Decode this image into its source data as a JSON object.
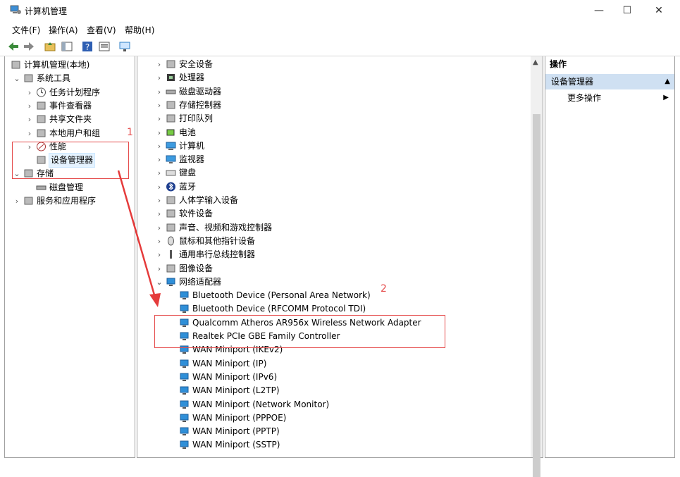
{
  "window": {
    "title": "计算机管理"
  },
  "menu": [
    "文件(F)",
    "操作(A)",
    "查看(V)",
    "帮助(H)"
  ],
  "left_tree": [
    {
      "label": "计算机管理(本地)",
      "exp": "",
      "indent": 0,
      "icon": "computer-management-icon"
    },
    {
      "label": "系统工具",
      "exp": "∨",
      "indent": 1,
      "icon": "tools-icon"
    },
    {
      "label": "任务计划程序",
      "exp": ">",
      "indent": 2,
      "icon": "clock-icon"
    },
    {
      "label": "事件查看器",
      "exp": ">",
      "indent": 2,
      "icon": "event-viewer-icon"
    },
    {
      "label": "共享文件夹",
      "exp": ">",
      "indent": 2,
      "icon": "shared-folder-icon"
    },
    {
      "label": "本地用户和组",
      "exp": ">",
      "indent": 2,
      "icon": "users-icon"
    },
    {
      "label": "性能",
      "exp": ">",
      "indent": 2,
      "icon": "performance-icon"
    },
    {
      "label": "设备管理器",
      "exp": "",
      "indent": 2,
      "icon": "device-manager-icon"
    },
    {
      "label": "存储",
      "exp": "∨",
      "indent": 1,
      "icon": "storage-icon"
    },
    {
      "label": "磁盘管理",
      "exp": "",
      "indent": 2,
      "icon": "disk-icon"
    },
    {
      "label": "服务和应用程序",
      "exp": ">",
      "indent": 1,
      "icon": "services-icon"
    }
  ],
  "device_tree": [
    {
      "label": "安全设备",
      "exp": ">",
      "indent": 0,
      "icon": "security-device-icon"
    },
    {
      "label": "处理器",
      "exp": ">",
      "indent": 0,
      "icon": "processor-icon"
    },
    {
      "label": "磁盘驱动器",
      "exp": ">",
      "indent": 0,
      "icon": "disk-drive-icon"
    },
    {
      "label": "存储控制器",
      "exp": ">",
      "indent": 0,
      "icon": "storage-controller-icon"
    },
    {
      "label": "打印队列",
      "exp": ">",
      "indent": 0,
      "icon": "printer-icon"
    },
    {
      "label": "电池",
      "exp": ">",
      "indent": 0,
      "icon": "battery-icon"
    },
    {
      "label": "计算机",
      "exp": ">",
      "indent": 0,
      "icon": "computer-icon"
    },
    {
      "label": "监视器",
      "exp": ">",
      "indent": 0,
      "icon": "monitor-icon"
    },
    {
      "label": "键盘",
      "exp": ">",
      "indent": 0,
      "icon": "keyboard-icon"
    },
    {
      "label": "蓝牙",
      "exp": ">",
      "indent": 0,
      "icon": "bluetooth-icon"
    },
    {
      "label": "人体学输入设备",
      "exp": ">",
      "indent": 0,
      "icon": "hid-icon"
    },
    {
      "label": "软件设备",
      "exp": ">",
      "indent": 0,
      "icon": "software-device-icon"
    },
    {
      "label": "声音、视频和游戏控制器",
      "exp": ">",
      "indent": 0,
      "icon": "sound-icon"
    },
    {
      "label": "鼠标和其他指针设备",
      "exp": ">",
      "indent": 0,
      "icon": "mouse-icon"
    },
    {
      "label": "通用串行总线控制器",
      "exp": ">",
      "indent": 0,
      "icon": "usb-icon"
    },
    {
      "label": "图像设备",
      "exp": ">",
      "indent": 0,
      "icon": "camera-icon"
    },
    {
      "label": "网络适配器",
      "exp": "∨",
      "indent": 0,
      "icon": "network-adapter-icon"
    },
    {
      "label": "Bluetooth Device (Personal Area Network)",
      "exp": "",
      "indent": 1,
      "icon": "network-adapter-icon"
    },
    {
      "label": "Bluetooth Device (RFCOMM Protocol TDI)",
      "exp": "",
      "indent": 1,
      "icon": "network-adapter-icon"
    },
    {
      "label": "Qualcomm Atheros AR956x Wireless Network Adapter",
      "exp": "",
      "indent": 1,
      "icon": "network-adapter-icon"
    },
    {
      "label": "Realtek PCIe GBE Family Controller",
      "exp": "",
      "indent": 1,
      "icon": "network-adapter-icon"
    },
    {
      "label": "WAN Miniport (IKEv2)",
      "exp": "",
      "indent": 1,
      "icon": "network-adapter-icon"
    },
    {
      "label": "WAN Miniport (IP)",
      "exp": "",
      "indent": 1,
      "icon": "network-adapter-icon"
    },
    {
      "label": "WAN Miniport (IPv6)",
      "exp": "",
      "indent": 1,
      "icon": "network-adapter-icon"
    },
    {
      "label": "WAN Miniport (L2TP)",
      "exp": "",
      "indent": 1,
      "icon": "network-adapter-icon"
    },
    {
      "label": "WAN Miniport (Network Monitor)",
      "exp": "",
      "indent": 1,
      "icon": "network-adapter-icon"
    },
    {
      "label": "WAN Miniport (PPPOE)",
      "exp": "",
      "indent": 1,
      "icon": "network-adapter-icon"
    },
    {
      "label": "WAN Miniport (PPTP)",
      "exp": "",
      "indent": 1,
      "icon": "network-adapter-icon"
    },
    {
      "label": "WAN Miniport (SSTP)",
      "exp": "",
      "indent": 1,
      "icon": "network-adapter-icon"
    }
  ],
  "actions": {
    "header": "操作",
    "selected": "设备管理器",
    "more": "更多操作"
  },
  "annotations": {
    "first": "1",
    "second": "2"
  },
  "colors": {
    "annotation": "#e54b4b",
    "selection": "#cfe0f2",
    "network_icon": "#2f8fd8"
  }
}
